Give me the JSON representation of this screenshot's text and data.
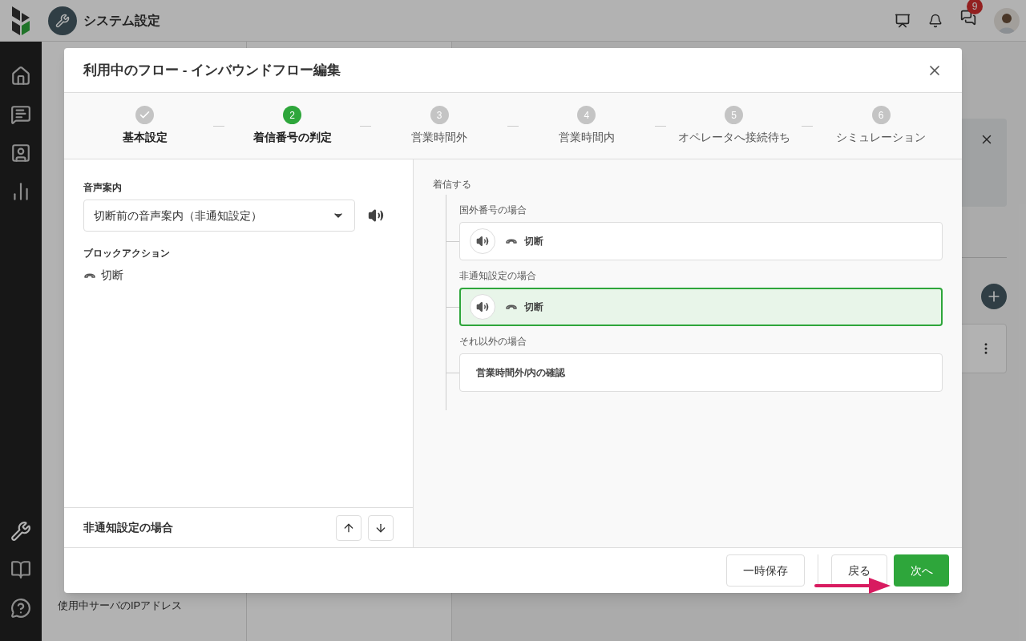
{
  "app_header": {
    "title": "システム設定",
    "notification_count": "9"
  },
  "settings_menu_item": "使用中サーバのIPアドレス",
  "modal": {
    "title": "利用中のフロー - インバウンドフロー編集",
    "steps": [
      {
        "completed": true,
        "selected": false,
        "label": "基本設定"
      },
      {
        "completed": false,
        "selected": true,
        "number": "2",
        "label": "着信番号の判定"
      },
      {
        "completed": false,
        "selected": false,
        "number": "3",
        "label": "営業時間外"
      },
      {
        "completed": false,
        "selected": false,
        "number": "4",
        "label": "営業時間内"
      },
      {
        "completed": false,
        "selected": false,
        "number": "5",
        "label": "オペレータへ接続待ち"
      },
      {
        "completed": false,
        "selected": false,
        "number": "6",
        "label": "シミュレーション"
      }
    ],
    "left_panel": {
      "voice_label": "音声案内",
      "voice_value": "切断前の音声案内（非通知設定）",
      "block_action_label": "ブロックアクション",
      "block_action": "切断",
      "current_branch": "非通知設定の場合"
    },
    "flow": {
      "root": "着信する",
      "branches": [
        {
          "condition": "国外番号の場合",
          "kind": "action",
          "text": "切断",
          "selected": false
        },
        {
          "condition": "非通知設定の場合",
          "kind": "action",
          "text": "切断",
          "selected": true
        },
        {
          "condition": "それ以外の場合",
          "kind": "next",
          "text": "営業時間外/内の確認",
          "selected": false
        }
      ]
    },
    "buttons": [
      {
        "label": "一時保存",
        "kind": "secondary"
      },
      {
        "label": "戻る",
        "kind": "secondary"
      },
      {
        "label": "次へ",
        "kind": "primary"
      }
    ]
  }
}
